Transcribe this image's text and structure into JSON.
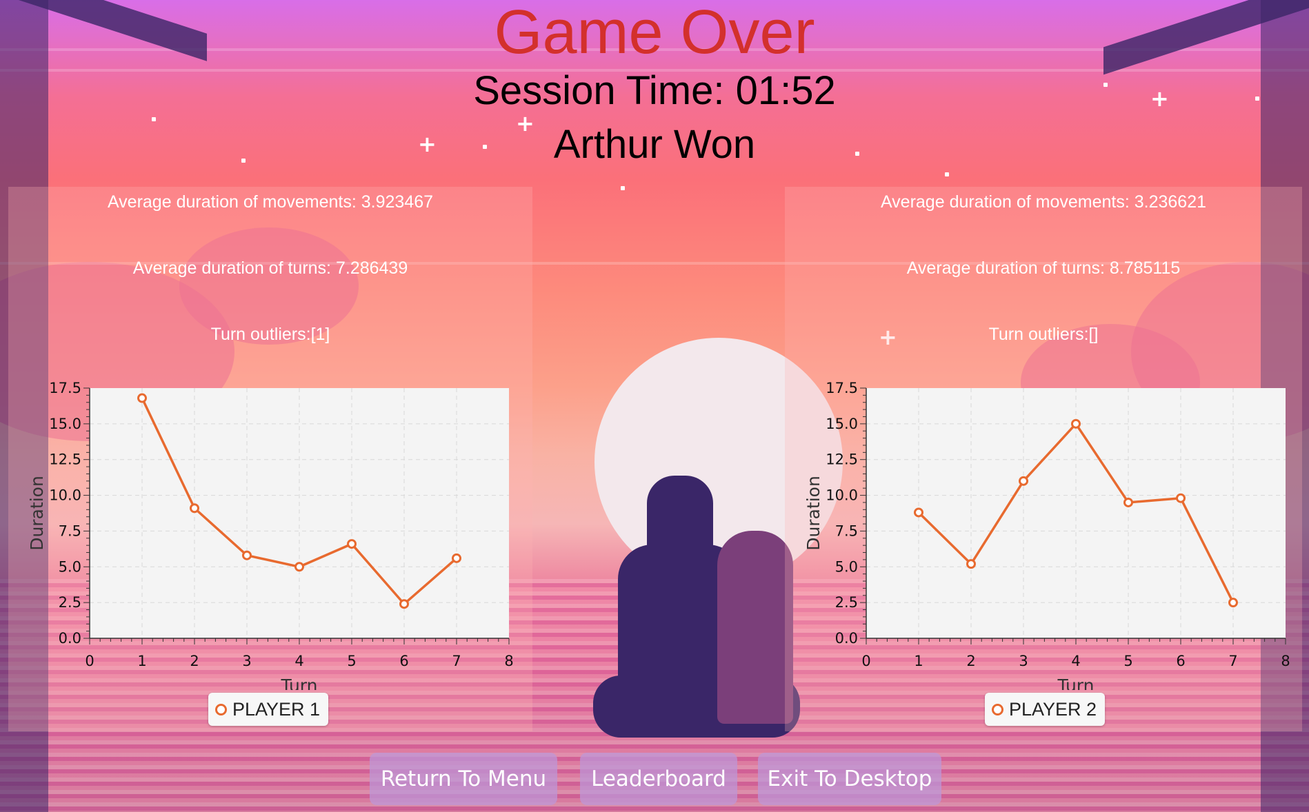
{
  "header": {
    "title": "Game Over",
    "session_time": "Session Time: 01:52",
    "winner": "Arthur Won"
  },
  "players": [
    {
      "avg_movements": "Average duration of movements: 3.923467",
      "avg_turns": "Average duration of turns: 7.286439",
      "outliers": "Turn outliers:[1]",
      "legend": "PLAYER 1"
    },
    {
      "avg_movements": "Average duration of movements: 3.236621",
      "avg_turns": "Average duration of turns: 8.785115",
      "outliers": "Turn outliers:[]",
      "legend": "PLAYER 2"
    }
  ],
  "buttons": {
    "return_menu": "Return To Menu",
    "leaderboard": "Leaderboard",
    "exit_desktop": "Exit To Desktop"
  },
  "colors": {
    "title": "#d3302c",
    "series": "#e86a2f",
    "plot_bg": "#f4f4f4"
  },
  "chart_data": [
    {
      "type": "line",
      "xlabel": "Turn",
      "ylabel": "Duration",
      "xlim": [
        0,
        8
      ],
      "ylim": [
        0,
        17.5
      ],
      "xticks": [
        "0",
        "1",
        "2",
        "3",
        "4",
        "5",
        "6",
        "7",
        "8"
      ],
      "yticks": [
        "0.0",
        "2.5",
        "5.0",
        "7.5",
        "10.0",
        "12.5",
        "15.0",
        "17.5"
      ],
      "grid": true,
      "legend_position": "bottom",
      "series": [
        {
          "name": "PLAYER 1",
          "x": [
            1,
            2,
            3,
            4,
            5,
            6,
            7
          ],
          "y": [
            16.8,
            9.1,
            5.8,
            5.0,
            6.6,
            2.4,
            5.6
          ]
        }
      ]
    },
    {
      "type": "line",
      "xlabel": "Turn",
      "ylabel": "Duration",
      "xlim": [
        0,
        8
      ],
      "ylim": [
        0,
        17.5
      ],
      "xticks": [
        "0",
        "1",
        "2",
        "3",
        "4",
        "5",
        "6",
        "7",
        "8"
      ],
      "yticks": [
        "0.0",
        "2.5",
        "5.0",
        "7.5",
        "10.0",
        "12.5",
        "15.0",
        "17.5"
      ],
      "grid": true,
      "legend_position": "bottom",
      "series": [
        {
          "name": "PLAYER 2",
          "x": [
            1,
            2,
            3,
            4,
            5,
            6,
            7
          ],
          "y": [
            8.8,
            5.2,
            11.0,
            15.0,
            9.5,
            9.8,
            2.5
          ]
        }
      ]
    }
  ]
}
